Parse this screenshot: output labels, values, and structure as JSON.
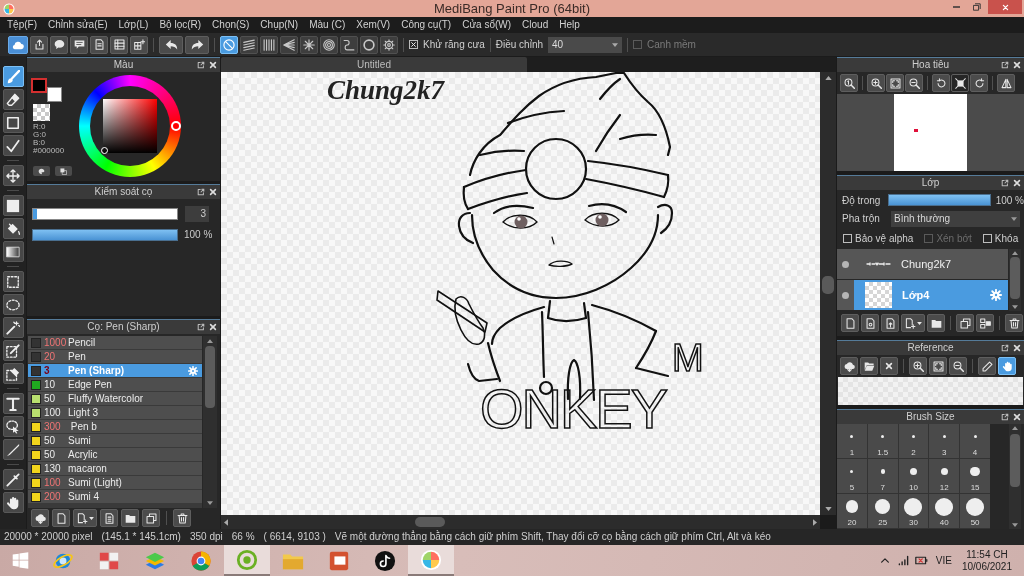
{
  "window": {
    "title": "MediBang Paint Pro (64bit)"
  },
  "menu": [
    "Tệp(F)",
    "Chỉnh sửa(E)",
    "Lớp(L)",
    "Bộ lọc(R)",
    "Chọn(S)",
    "Chụp(N)",
    "Màu (C)",
    "Xem(V)",
    "Công cụ(T)",
    "Cửa sổ(W)",
    "Cloud",
    "Help"
  ],
  "toolbar": {
    "snap_modes": [
      {
        "selected": true
      },
      {
        "selected": false
      },
      {
        "selected": false
      },
      {
        "selected": false
      },
      {
        "selected": false
      },
      {
        "selected": false
      },
      {
        "selected": false
      },
      {
        "selected": false
      },
      {
        "selected": false
      }
    ],
    "antialias": {
      "label": "Khử răng cưa",
      "checked": true
    },
    "correction": {
      "label": "Điều chỉnh",
      "value": "40"
    },
    "soft_edge": {
      "label": "Canh mềm",
      "checked": false,
      "disabled": true
    }
  },
  "tools": [
    {
      "selected": true
    },
    {
      "selected": false
    },
    {
      "selected": false
    },
    {
      "selected": false
    },
    {
      "selected": false
    },
    {
      "selected": false
    },
    {
      "selected": false
    },
    {
      "selected": false
    },
    {
      "selected": false
    },
    {
      "selected": false
    },
    {
      "selected": false
    },
    {
      "selected": false
    },
    {
      "selected": false
    },
    {
      "selected": false
    },
    {
      "selected": false
    },
    {
      "selected": false
    },
    {
      "selected": false
    },
    {
      "selected": false
    }
  ],
  "color_panel": {
    "title": "Màu",
    "swatches": [
      {
        "kind": "foreground",
        "color": "#000000"
      },
      {
        "kind": "background",
        "color": "#ffffff"
      }
    ],
    "readout": [
      "R:0",
      "G:0",
      "B:0",
      "#000000"
    ]
  },
  "brush_control": {
    "title": "Kiểm soát cọ",
    "size": {
      "level": 0.03,
      "value": "3"
    },
    "opacity": {
      "level": 1,
      "reading": "100 %"
    }
  },
  "brush_panel": {
    "title": "Cọ: Pen (Sharp)",
    "brushes": [
      {
        "size": "1000",
        "name": "Pencil",
        "color": "#333333",
        "highlighted": true,
        "selected": false
      },
      {
        "size": "20",
        "name": "Pen",
        "color": "#333333",
        "highlighted": true,
        "selected": false
      },
      {
        "size": "3",
        "name": "Pen (Sharp)",
        "color": "#333333",
        "highlighted": true,
        "selected": true
      },
      {
        "size": "10",
        "name": "Edge Pen",
        "color": "#1faa1f",
        "highlighted": false,
        "selected": false
      },
      {
        "size": "50",
        "name": "Fluffy Watercolor",
        "color": "#b9e06f",
        "highlighted": false,
        "selected": false
      },
      {
        "size": "100",
        "name": "Light 3",
        "color": "#b9e06f",
        "highlighted": false,
        "selected": false
      },
      {
        "size": "300",
        "name": " Pen b",
        "color": "#f2d51c",
        "highlighted": true,
        "selected": false
      },
      {
        "size": "50",
        "name": "Sumi",
        "color": "#f2d51c",
        "highlighted": false,
        "selected": false
      },
      {
        "size": "50",
        "name": "Acrylic",
        "color": "#f2d51c",
        "highlighted": false,
        "selected": false
      },
      {
        "size": "130",
        "name": "macaron",
        "color": "#f2d51c",
        "highlighted": false,
        "selected": false
      },
      {
        "size": "100",
        "name": "Sumi (Light)",
        "color": "#f2d51c",
        "highlighted": true,
        "selected": false
      },
      {
        "size": "200",
        "name": "Sumi 4",
        "color": "#f2d51c",
        "highlighted": true,
        "selected": false
      }
    ]
  },
  "canvas": {
    "tab": "Untitled",
    "text": "Chung2k7",
    "lettering": [
      "M",
      "ONKEY"
    ]
  },
  "navigator": {
    "title": "Hoa tiêu"
  },
  "layer_panel": {
    "title": "Lớp",
    "opacity": {
      "label": "Độ trong",
      "level": 1,
      "reading": "100 %"
    },
    "blend": {
      "label": "Pha trộn",
      "value": "Bình thường"
    },
    "options": [
      {
        "label": "Bảo vệ alpha",
        "checked": false,
        "disabled": false
      },
      {
        "label": "Xén bớt",
        "checked": false,
        "disabled": true
      },
      {
        "label": "Khóa",
        "checked": false,
        "disabled": false
      }
    ],
    "layers": [
      {
        "name": "Chung2k7",
        "kind": "text",
        "visible": true,
        "selected": false
      },
      {
        "name": "Lớp4",
        "kind": "raster",
        "visible": true,
        "selected": true
      }
    ]
  },
  "reference": {
    "title": "Reference",
    "tools": [
      {
        "selected": false
      },
      {
        "selected": false
      },
      {
        "selected": false
      },
      {
        "selected": false
      },
      {
        "selected": false
      },
      {
        "selected": false
      },
      {
        "selected": false
      },
      {
        "selected": true
      }
    ]
  },
  "brush_size": {
    "title": "Brush Size",
    "sizes": [
      "1",
      "1.5",
      "2",
      "3",
      "4",
      "5",
      "7",
      "10",
      "12",
      "15",
      "20",
      "25",
      "30",
      "40",
      "50"
    ]
  },
  "status_bar": [
    "20000 * 20000 pixel",
    "(145.1 * 145.1cm)",
    "350 dpi",
    "66 %",
    "( 6614, 9103 )",
    "Vẽ một đường thẳng bằng cách giữ phím Shift, Thay đổi cỡ cọ bằng cách giữ phím Ctrl, Alt và kéo"
  ],
  "taskbar": {
    "apps": [
      {
        "active": false
      },
      {
        "active": false
      },
      {
        "active": false
      },
      {
        "active": false
      },
      {
        "active": true
      },
      {
        "active": false
      },
      {
        "active": false
      },
      {
        "active": false
      },
      {
        "active": true
      }
    ],
    "language": "VIE",
    "time": "11:54 CH",
    "date": "10/06/2021"
  }
}
